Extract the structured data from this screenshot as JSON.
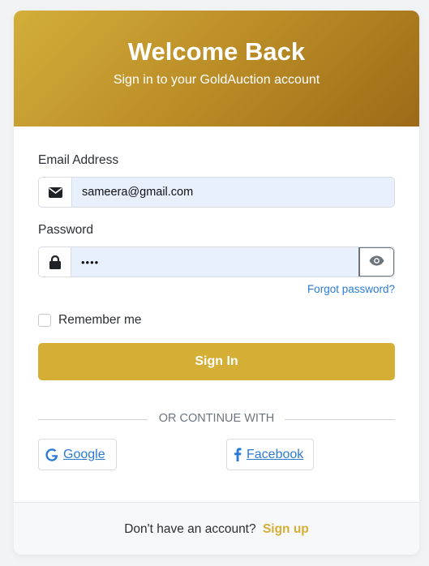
{
  "header": {
    "title": "Welcome Back",
    "subtitle": "Sign in to your GoldAuction account"
  },
  "form": {
    "email": {
      "label": "Email Address",
      "value": "sameera@gmail.com",
      "icon": "envelope-icon"
    },
    "password": {
      "label": "Password",
      "value": "••••",
      "icon": "lock-icon",
      "toggle_icon": "eye-icon"
    },
    "forgot_label": "Forgot password?",
    "remember_label": "Remember me",
    "submit_label": "Sign In"
  },
  "divider": {
    "text": "OR CONTINUE WITH"
  },
  "social": {
    "google_label": "Google",
    "facebook_label": "Facebook"
  },
  "footer": {
    "prompt": "Don't have an account?",
    "signup_label": "Sign up"
  },
  "colors": {
    "brand": "#d4ae35",
    "link": "#2b7bd6",
    "input_fill": "#e8f0fe"
  }
}
